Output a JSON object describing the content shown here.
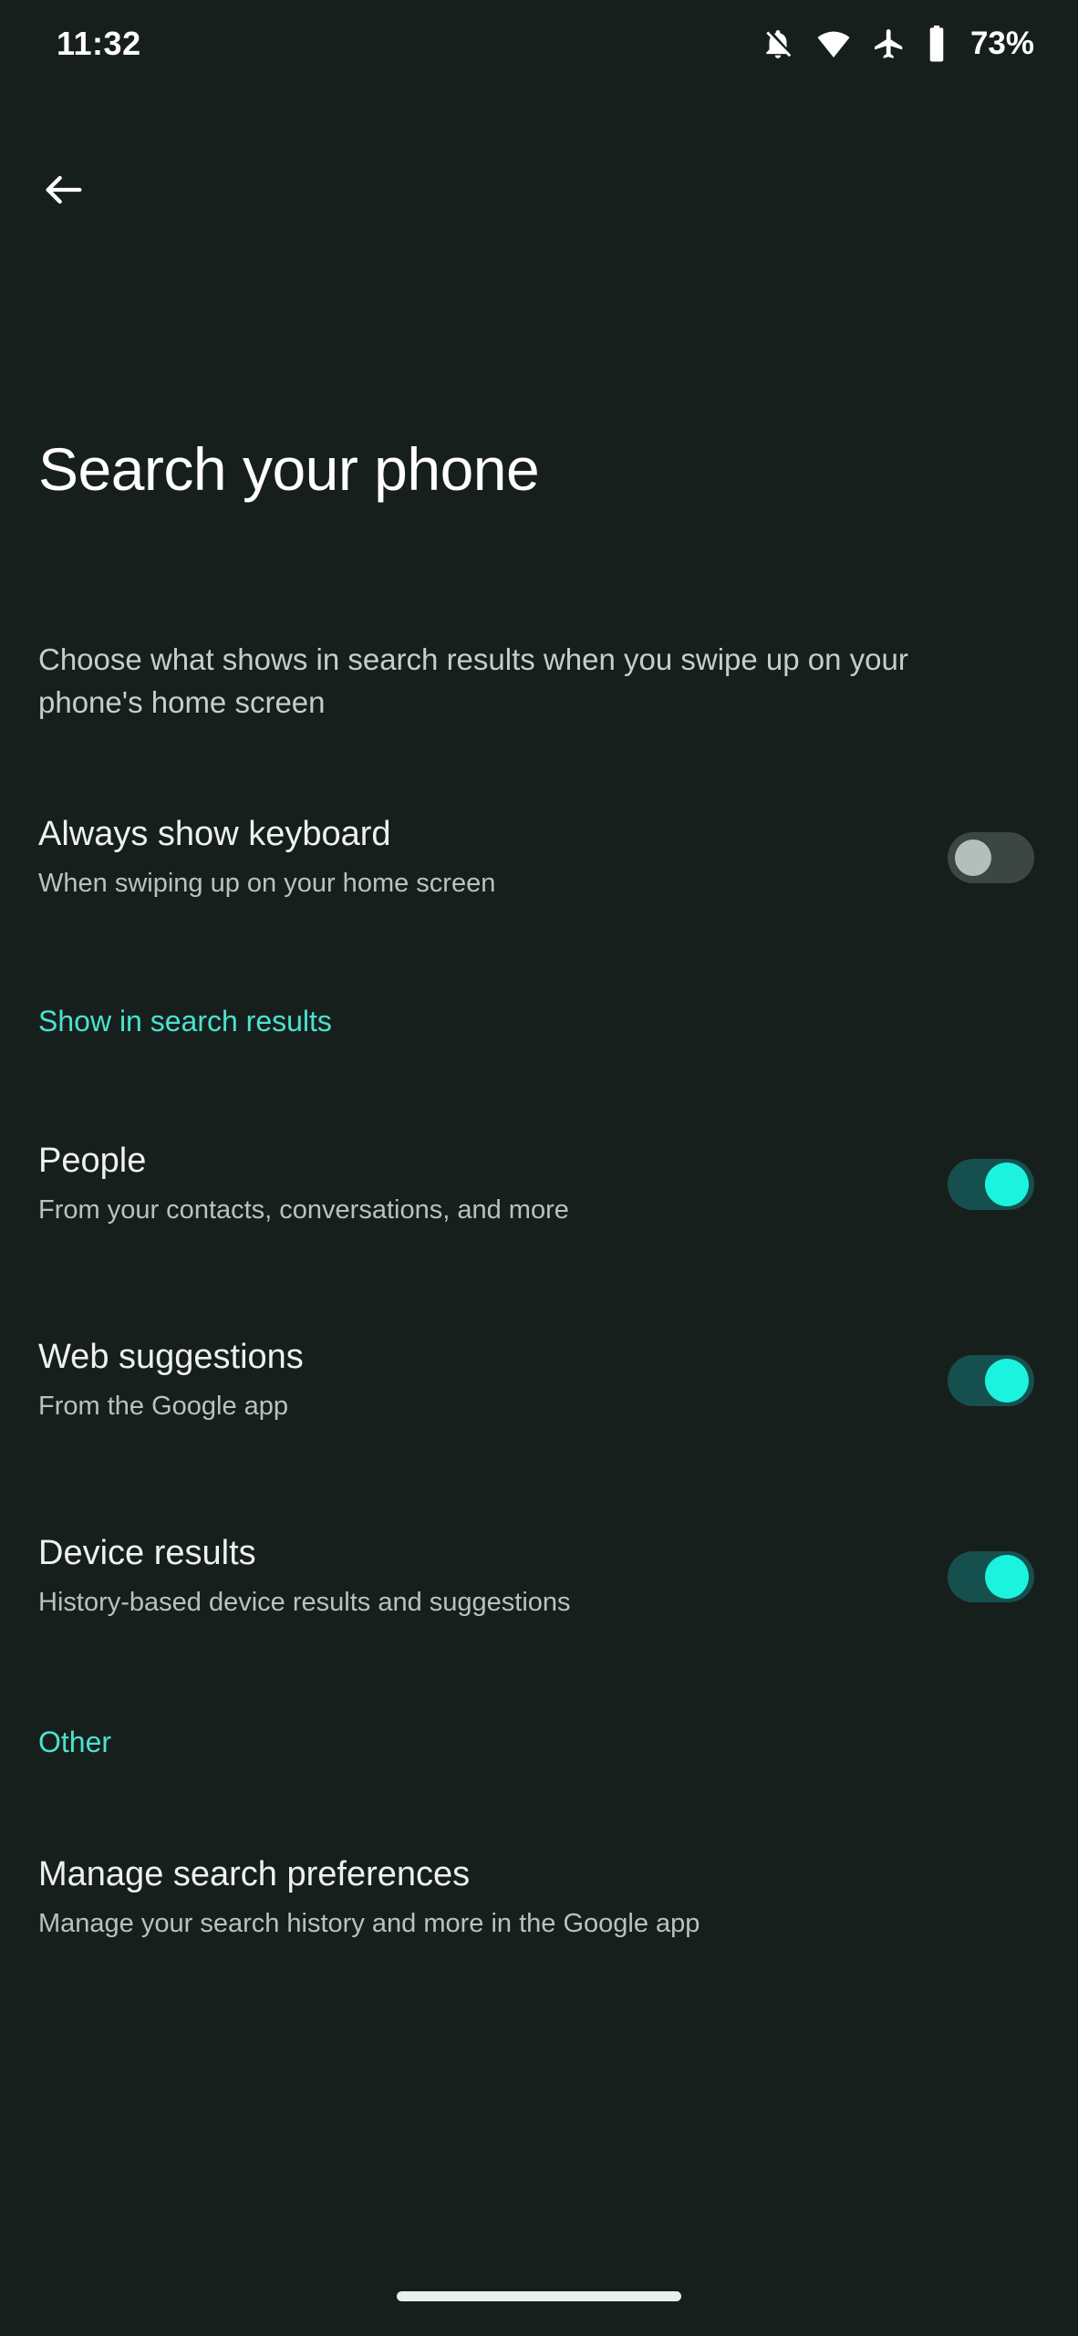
{
  "status_bar": {
    "time": "11:32",
    "battery_percent": "73%",
    "icons": [
      "notifications-off-icon",
      "wifi-icon",
      "airplane-mode-icon",
      "battery-icon"
    ]
  },
  "nav": {
    "back_icon": "arrow-left-icon"
  },
  "header": {
    "title": "Search your phone",
    "description": "Choose what shows in search results when you swipe up on your phone's home screen"
  },
  "top_setting": {
    "title": "Always show keyboard",
    "subtitle": "When swiping up on your home screen",
    "enabled": false
  },
  "sections": [
    {
      "heading": "Show in search results",
      "items": [
        {
          "title": "People",
          "subtitle": "From your contacts, conversations, and more",
          "enabled": true
        },
        {
          "title": "Web suggestions",
          "subtitle": "From the Google app",
          "enabled": true
        },
        {
          "title": "Device results",
          "subtitle": "History-based device results and suggestions",
          "enabled": true
        }
      ]
    },
    {
      "heading": "Other",
      "items": [
        {
          "title": "Manage search preferences",
          "subtitle": "Manage your search history and more in the Google app",
          "enabled": null
        }
      ]
    }
  ],
  "colors": {
    "background": "#171f1d",
    "accent": "#4ae2d0",
    "switch_on_thumb": "#1bf3de",
    "switch_on_track": "#16504e",
    "switch_off_thumb": "#b2bfbb",
    "switch_off_track": "#3c4643",
    "primary_text": "#eef1ef",
    "secondary_text": "#b9c2bf"
  }
}
